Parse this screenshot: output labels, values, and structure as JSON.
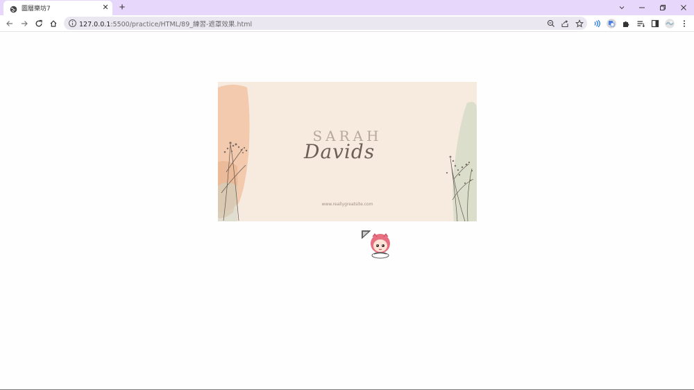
{
  "browser": {
    "tab": {
      "title": "圖層樂坊7",
      "favicon": "globe-icon",
      "close_glyph": "✕"
    },
    "new_tab_glyph": "+",
    "window_controls": [
      "chevron-down-icon",
      "minimize-icon",
      "restore-icon",
      "close-icon"
    ],
    "nav": [
      "back-arrow-icon",
      "forward-arrow-icon",
      "reload-icon",
      "home-icon"
    ],
    "address": {
      "host": "127.0.0.1",
      "path": ":5500/practice/HTML/89_練習-遮罩效果.html"
    },
    "omnibox_icons": [
      "zoom-icon",
      "share-icon",
      "star-icon"
    ],
    "extensions": [
      "read-aloud-icon",
      "translate-icon",
      "puzzle-icon",
      "reading-list-icon",
      "side-panel-icon",
      "profile-avatar-icon",
      "kebab-menu-icon"
    ],
    "accent_color": "#e7d8fb"
  },
  "card": {
    "first_name": "SARAH",
    "last_name": "Davids",
    "website": "www.reallygreatsite.com",
    "background": "#f7ebe0"
  },
  "overlay": {
    "cursor": "cursor-icon",
    "mascot": "chibi-character-icon"
  }
}
